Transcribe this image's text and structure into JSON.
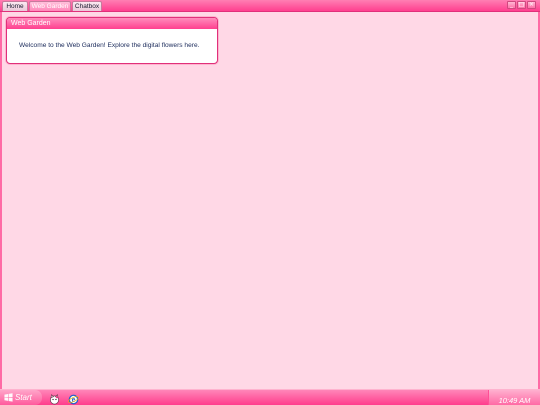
{
  "tabs": [
    {
      "label": "Home",
      "active": false
    },
    {
      "label": "Web Garden",
      "active": true
    },
    {
      "label": "Chatbox",
      "active": false
    }
  ],
  "window_controls": {
    "minimize": "_",
    "maximize": "□",
    "close": "×"
  },
  "dialog": {
    "title": "Web Garden",
    "message": "Welcome to the Web Garden! Explore the digital flowers here."
  },
  "taskbar": {
    "start_label": "Start",
    "quick_launch": [
      "cat-icon",
      "internet-explorer-icon"
    ],
    "clock": "10:49 AM"
  },
  "colors": {
    "background": "#ffd8e6",
    "accent": "#ff3f8f",
    "text": "#1a2a5a"
  }
}
